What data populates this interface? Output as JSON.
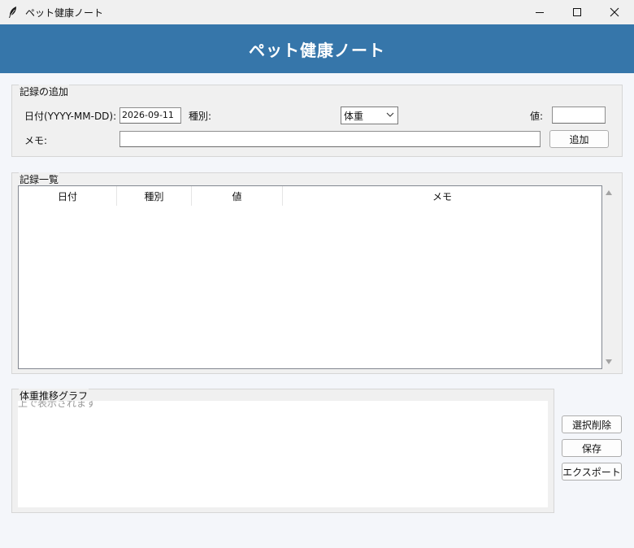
{
  "window": {
    "title": "ペット健康ノート",
    "icon": "feather-icon",
    "controls": [
      "minimize-icon",
      "maximize-icon",
      "close-icon"
    ]
  },
  "header": {
    "title": "ペット健康ノート",
    "background": "#3676aa"
  },
  "add_record": {
    "group_title": "記録の追加",
    "date_label": "日付(YYYY-MM-DD):",
    "date_value": "2026-09-11",
    "type_label": "種別:",
    "type_selected": "体重",
    "value_label": "値:",
    "value_value": "",
    "memo_label": "メモ:",
    "memo_value": "",
    "add_button": "追加"
  },
  "records": {
    "group_title": "記録一覧",
    "columns": [
      "日付",
      "種別",
      "値",
      "メモ"
    ],
    "rows": []
  },
  "graph": {
    "group_title": "体重推移グラフ",
    "placeholder": "上で表示されます"
  },
  "actions": {
    "delete_button": "選択削除",
    "save_button": "保存",
    "export_button": "エクスポート"
  }
}
